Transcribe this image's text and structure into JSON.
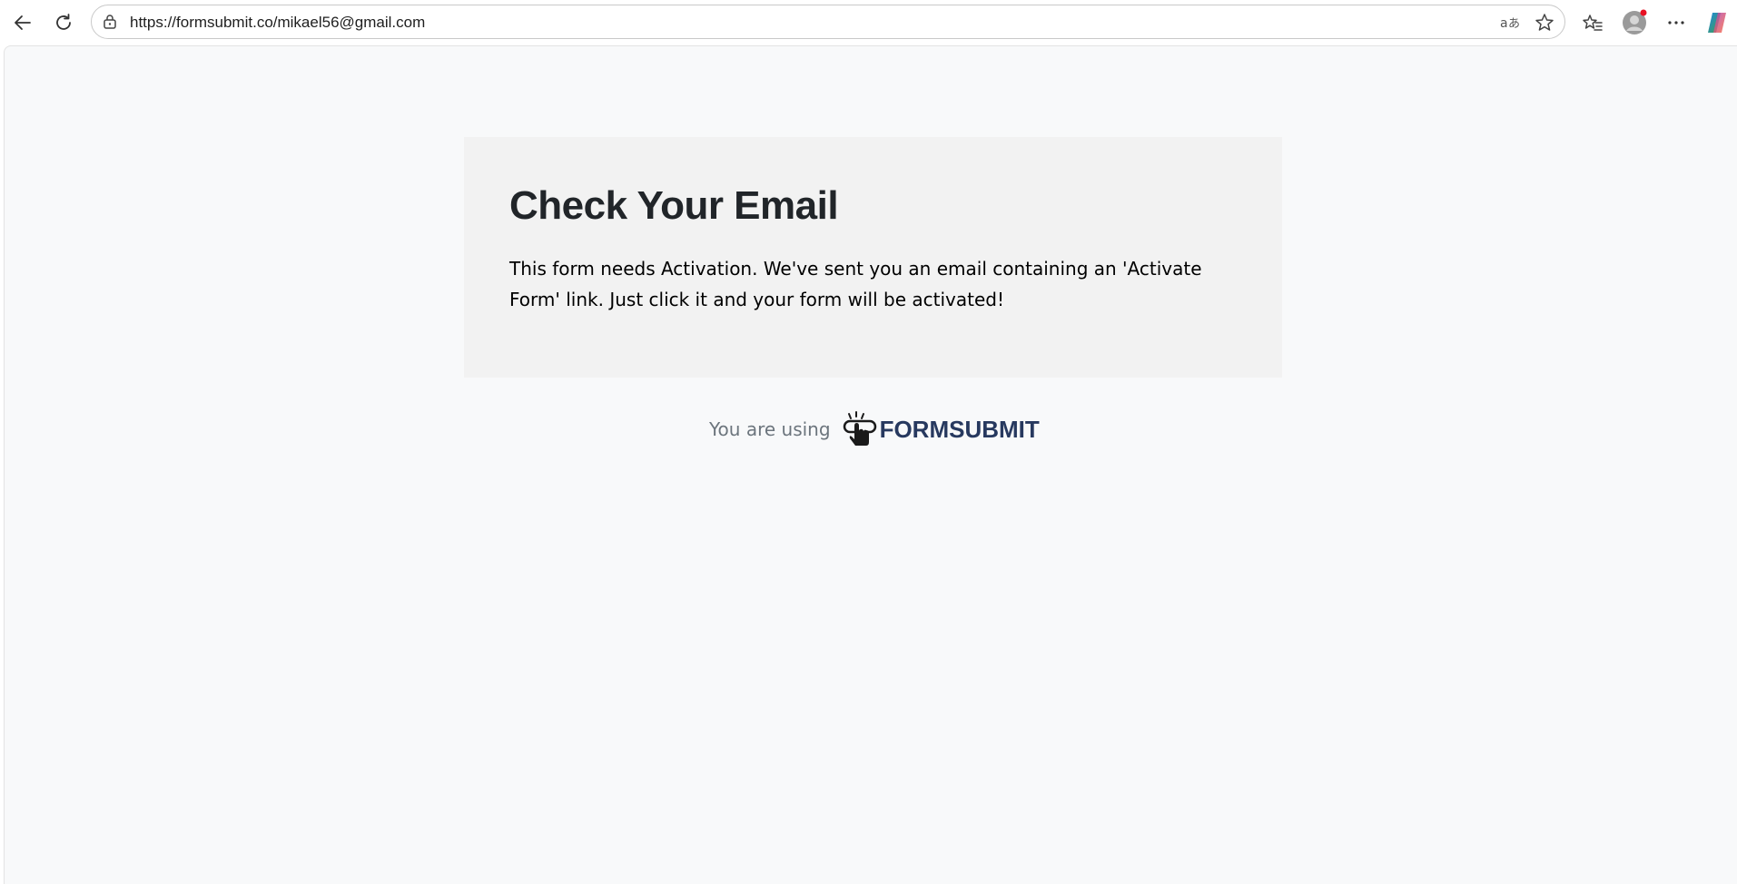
{
  "browser": {
    "url": "https://formsubmit.co/mikael56@gmail.com",
    "icons": {
      "back": "back-arrow-icon",
      "reload": "reload-icon",
      "lock": "lock-icon",
      "translate": "translate-icon",
      "favorite": "star-icon",
      "favorites_list": "favorites-icon",
      "profile": "profile-avatar-icon",
      "menu": "more-icon",
      "copilot": "copilot-icon"
    },
    "notification_dot_color": "#e81123"
  },
  "card": {
    "title": "Check Your Email",
    "message": "This form needs Activation. We've sent you an email containing an 'Activate Form' link. Just click it and your form will be activated!"
  },
  "footer": {
    "using_label": "You are using",
    "brand_name": "FORMSUBMIT",
    "brand_color": "#27395f"
  }
}
